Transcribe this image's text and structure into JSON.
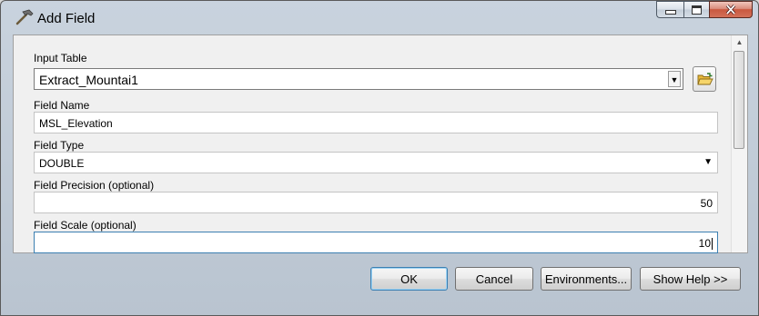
{
  "window": {
    "title": "Add Field",
    "app_icon": "hammer-icon",
    "caption_icons": [
      "minimize-icon",
      "maximize-icon",
      "close-icon"
    ]
  },
  "form": {
    "input_table": {
      "label": "Input Table",
      "value": "Extract_Mountai1",
      "browse_icon": "open-folder-icon"
    },
    "field_name": {
      "label": "Field Name",
      "value": "MSL_Elevation"
    },
    "field_type": {
      "label": "Field Type",
      "value": "DOUBLE"
    },
    "field_precision": {
      "label": "Field Precision (optional)",
      "value": "50"
    },
    "field_scale": {
      "label": "Field Scale (optional)",
      "value": "10"
    }
  },
  "buttons": {
    "ok": "OK",
    "cancel": "Cancel",
    "environments": "Environments...",
    "show_help": "Show Help >>"
  },
  "colors": {
    "focus_border": "#3c7fb1",
    "close_button": "#c9583f"
  }
}
